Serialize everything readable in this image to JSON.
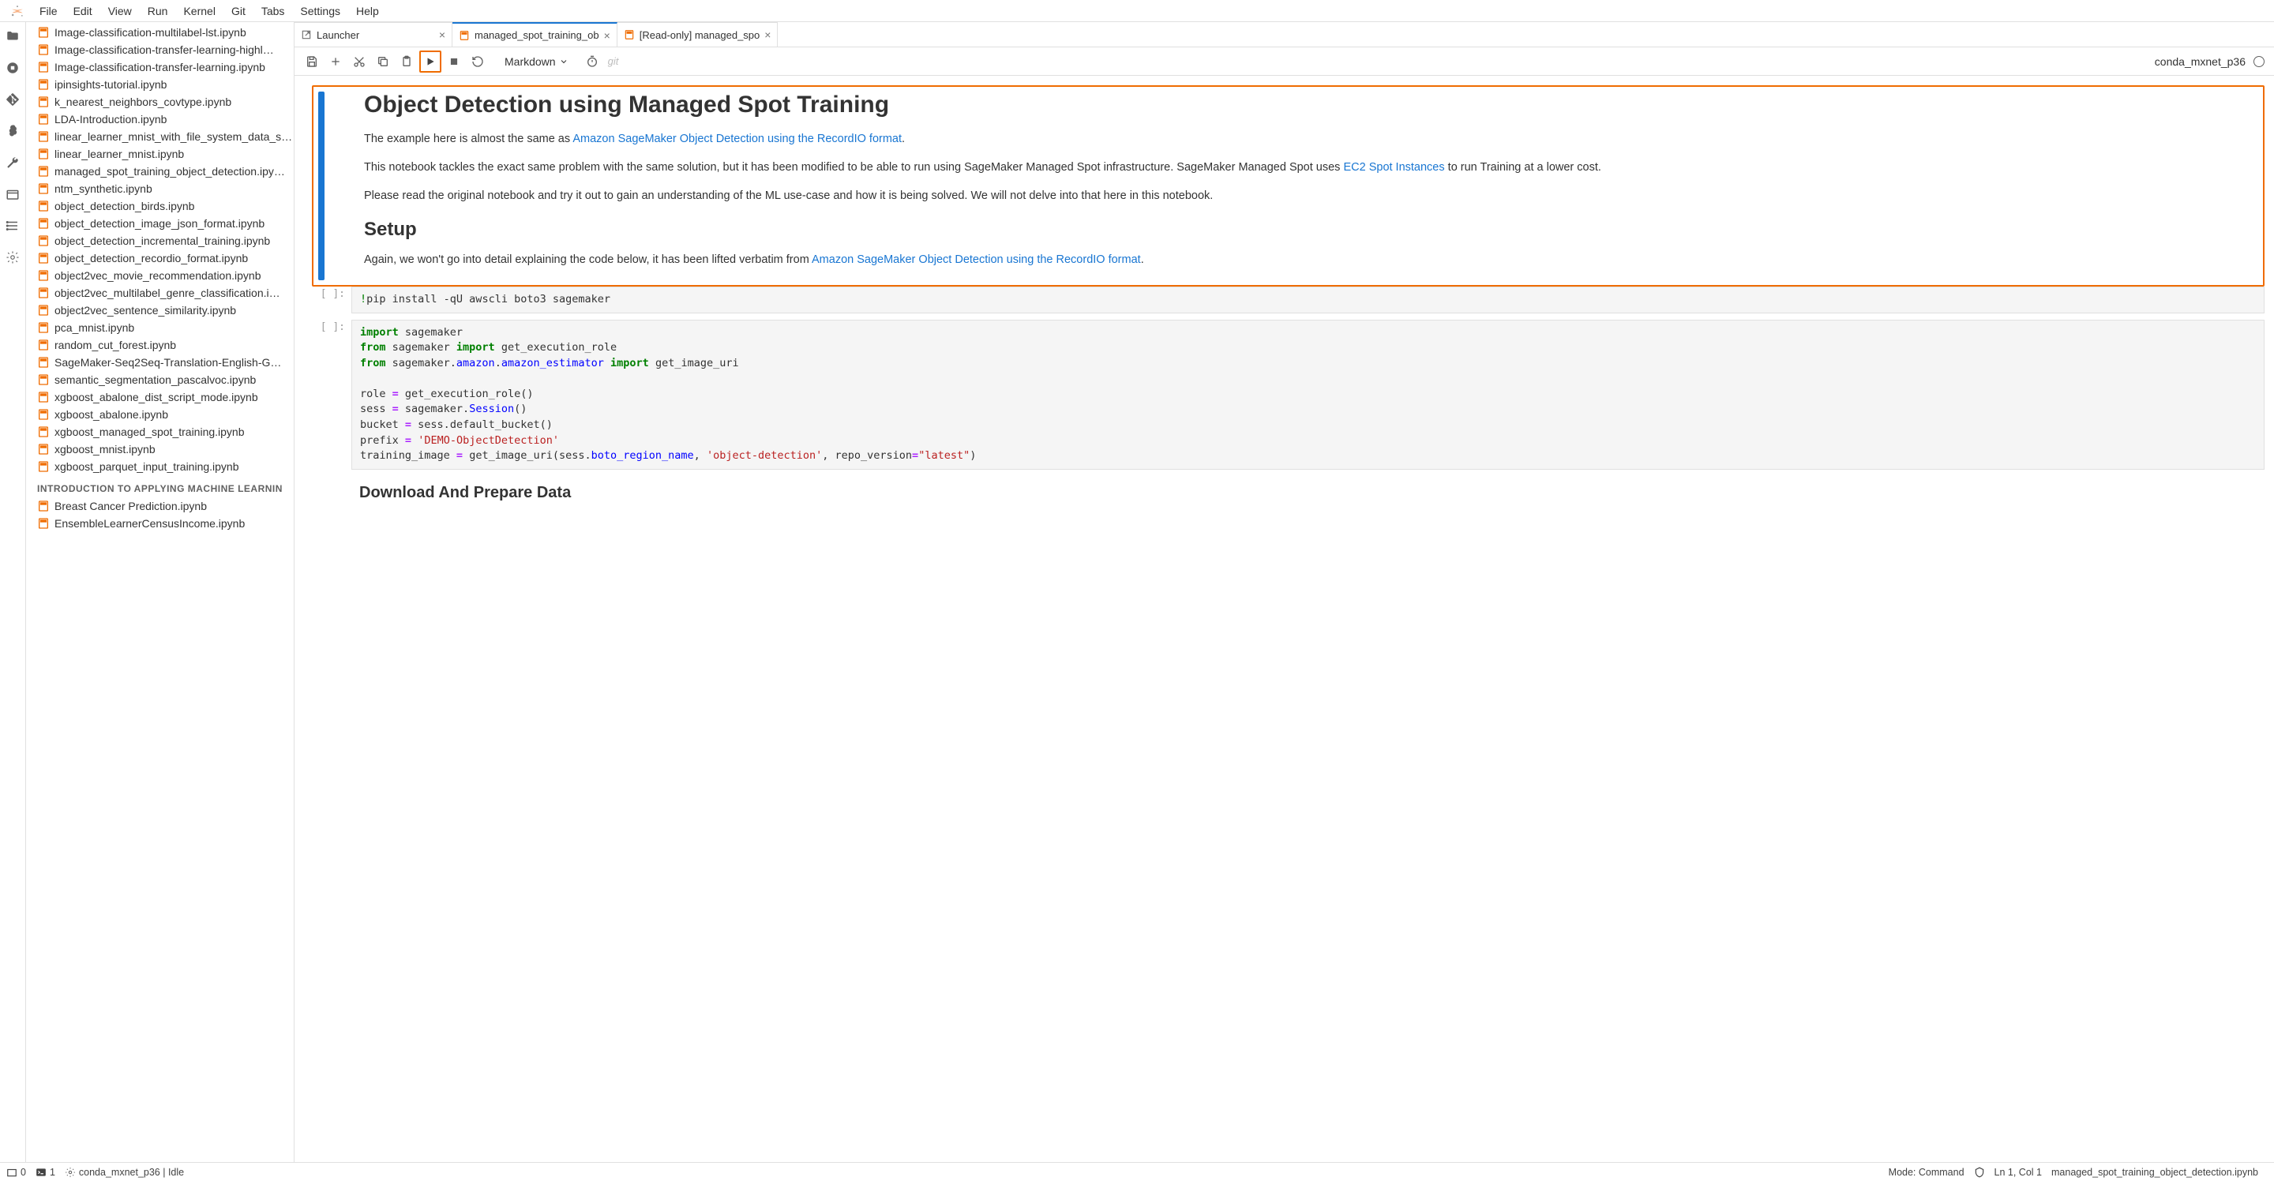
{
  "menubar": [
    "File",
    "Edit",
    "View",
    "Run",
    "Kernel",
    "Git",
    "Tabs",
    "Settings",
    "Help"
  ],
  "files": [
    "Image-classification-multilabel-lst.ipynb",
    "Image-classification-transfer-learning-highl…",
    "Image-classification-transfer-learning.ipynb",
    "ipinsights-tutorial.ipynb",
    "k_nearest_neighbors_covtype.ipynb",
    "LDA-Introduction.ipynb",
    "linear_learner_mnist_with_file_system_data_s…",
    "linear_learner_mnist.ipynb",
    "managed_spot_training_object_detection.ipy…",
    "ntm_synthetic.ipynb",
    "object_detection_birds.ipynb",
    "object_detection_image_json_format.ipynb",
    "object_detection_incremental_training.ipynb",
    "object_detection_recordio_format.ipynb",
    "object2vec_movie_recommendation.ipynb",
    "object2vec_multilabel_genre_classification.i…",
    "object2vec_sentence_similarity.ipynb",
    "pca_mnist.ipynb",
    "random_cut_forest.ipynb",
    "SageMaker-Seq2Seq-Translation-English-G…",
    "semantic_segmentation_pascalvoc.ipynb",
    "xgboost_abalone_dist_script_mode.ipynb",
    "xgboost_abalone.ipynb",
    "xgboost_managed_spot_training.ipynb",
    "xgboost_mnist.ipynb",
    "xgboost_parquet_input_training.ipynb"
  ],
  "section_header": "INTRODUCTION TO APPLYING MACHINE LEARNIN",
  "files2": [
    "Breast Cancer Prediction.ipynb",
    "EnsembleLearnerCensusIncome.ipynb"
  ],
  "tabs": [
    {
      "label": "Launcher",
      "icon": "launcher",
      "active": false
    },
    {
      "label": "managed_spot_training_ob",
      "icon": "notebook",
      "active": true
    },
    {
      "label": "[Read-only] managed_spo",
      "icon": "notebook",
      "active": false
    }
  ],
  "toolbar": {
    "celltype": "Markdown",
    "git_label": "git",
    "kernel_name": "conda_mxnet_p36"
  },
  "notebook": {
    "h1": "Object Detection using Managed Spot Training",
    "p1a": "The example here is almost the same as ",
    "p1_link": "Amazon SageMaker Object Detection using the RecordIO format",
    "p1b": ".",
    "p2a": "This notebook tackles the exact same problem with the same solution, but it has been modified to be able to run using SageMaker Managed Spot infrastructure. SageMaker Managed Spot uses ",
    "p2_link": "EC2 Spot Instances",
    "p2b": " to run Training at a lower cost.",
    "p3": "Please read the original notebook and try it out to gain an understanding of the ML use-case and how it is being solved. We will not delve into that here in this notebook.",
    "h2": "Setup",
    "p4a": "Again, we won't go into detail explaining the code below, it has been lifted verbatim from ",
    "p4_link": "Amazon SageMaker Object Detection using the RecordIO format",
    "p4b": ".",
    "h3": "Download And Prepare Data"
  },
  "code1": "!pip install -qU awscli boto3 sagemaker",
  "code2_lines": [
    [
      {
        "t": "import",
        "c": "tok-kw"
      },
      {
        "t": " sagemaker"
      }
    ],
    [
      {
        "t": "from",
        "c": "tok-kw"
      },
      {
        "t": " sagemaker "
      },
      {
        "t": "import",
        "c": "tok-kw"
      },
      {
        "t": " get_execution_role"
      }
    ],
    [
      {
        "t": "from",
        "c": "tok-kw"
      },
      {
        "t": " sagemaker"
      },
      {
        "t": "."
      },
      {
        "t": "amazon",
        "c": "tok-mod"
      },
      {
        "t": "."
      },
      {
        "t": "amazon_estimator",
        "c": "tok-mod"
      },
      {
        "t": " "
      },
      {
        "t": "import",
        "c": "tok-kw"
      },
      {
        "t": " get_image_uri"
      }
    ],
    [],
    [
      {
        "t": "role "
      },
      {
        "t": "=",
        "c": "tok-op"
      },
      {
        "t": " get_execution_role()"
      }
    ],
    [
      {
        "t": "sess "
      },
      {
        "t": "=",
        "c": "tok-op"
      },
      {
        "t": " sagemaker"
      },
      {
        "t": "."
      },
      {
        "t": "Session",
        "c": "tok-fn"
      },
      {
        "t": "()"
      }
    ],
    [
      {
        "t": "bucket "
      },
      {
        "t": "=",
        "c": "tok-op"
      },
      {
        "t": " sess"
      },
      {
        "t": "."
      },
      {
        "t": "default_bucket"
      },
      {
        "t": "()"
      }
    ],
    [
      {
        "t": "prefix "
      },
      {
        "t": "=",
        "c": "tok-op"
      },
      {
        "t": " "
      },
      {
        "t": "'DEMO-ObjectDetection'",
        "c": "tok-str"
      }
    ],
    [
      {
        "t": "training_image "
      },
      {
        "t": "=",
        "c": "tok-op"
      },
      {
        "t": " get_image_uri(sess"
      },
      {
        "t": "."
      },
      {
        "t": "boto_region_name",
        "c": "tok-fn"
      },
      {
        "t": ", "
      },
      {
        "t": "'object-detection'",
        "c": "tok-str"
      },
      {
        "t": ", repo_version"
      },
      {
        "t": "=",
        "c": "tok-op"
      },
      {
        "t": "\"latest\"",
        "c": "tok-str"
      },
      {
        "t": ")"
      }
    ]
  ],
  "statusbar": {
    "tabs_count": "0",
    "terminals_count": "1",
    "kernel_info": "conda_mxnet_p36 | Idle",
    "mode": "Mode: Command",
    "cursor": "Ln 1, Col 1",
    "filename": "managed_spot_training_object_detection.ipynb"
  }
}
